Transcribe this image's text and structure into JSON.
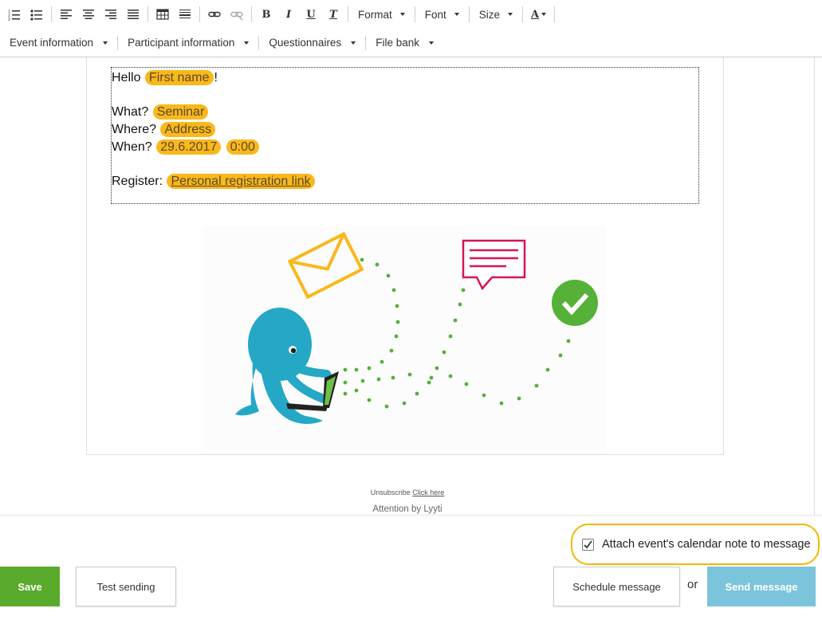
{
  "toolbar": {
    "format_label": "Format",
    "font_label": "Font",
    "size_label": "Size",
    "bold_glyph": "B",
    "italic_glyph": "I",
    "underline_glyph": "U",
    "clear_glyph": "T",
    "color_glyph": "A"
  },
  "insert_menu": {
    "event_information": "Event information",
    "participant_information": "Participant information",
    "questionnaires": "Questionnaires",
    "file_bank": "File bank"
  },
  "message": {
    "hello": "Hello",
    "first_name_tag": "First name",
    "exclaim": "!",
    "what_label": "What?",
    "what_tag": "Seminar",
    "where_label": "Where?",
    "where_tag": "Address",
    "when_label": "When?",
    "date_tag": "29.6.2017",
    "time_tag": "0:00",
    "register_label": "Register:",
    "register_tag": "Personal registration link"
  },
  "footer": {
    "unsubscribe_text": "Unsubscribe",
    "unsubscribe_link": "Click here",
    "attention": "Attention by Lyyti"
  },
  "actions": {
    "attach_label": "Attach event's calendar note to message",
    "attach_checked": true,
    "save": "Save",
    "test_sending": "Test sending",
    "schedule": "Schedule message",
    "or": "or",
    "send": "Send message"
  },
  "colors": {
    "tag": "#f9b81c",
    "save_green": "#5aaa2b",
    "send_blue": "#7cc4dc",
    "highlight": "#f5b800",
    "octopus": "#25a8c6",
    "check_green": "#56b139",
    "speech_red": "#d6145b"
  }
}
